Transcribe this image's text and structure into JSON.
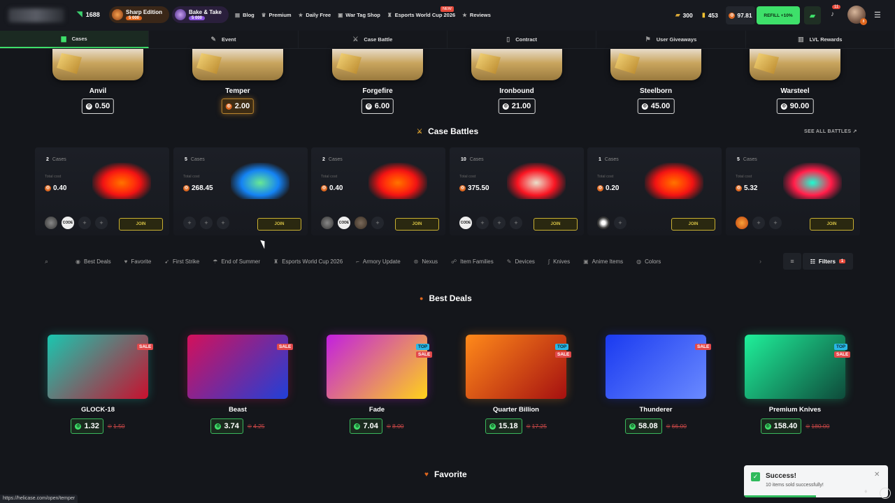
{
  "header": {
    "online_count": "1688",
    "promos": [
      {
        "title": "Sharp Edition",
        "sub": "5 000",
        "color": "#e0671e"
      },
      {
        "title": "Bake & Take",
        "sub": "5 000",
        "color": "#8a52e0"
      }
    ],
    "nav": [
      {
        "label": "Blog",
        "icon": "blog-icon"
      },
      {
        "label": "Premium",
        "icon": "crown-icon"
      },
      {
        "label": "Daily Free",
        "icon": "star-icon"
      },
      {
        "label": "War Tag Shop",
        "icon": "shop-icon"
      },
      {
        "label": "Esports World Cup 2026",
        "icon": "trophy-icon"
      },
      {
        "label": "Reviews",
        "icon": "star-icon"
      }
    ],
    "new_badge": "NEW",
    "coins_gold": "300",
    "coins_yellow": "453",
    "balance": "97.81",
    "refill_label": "REFILL +10%",
    "notifications": "11",
    "level": "8"
  },
  "tabs": [
    {
      "label": "Cases",
      "icon": "case-icon"
    },
    {
      "label": "Event",
      "icon": "pen-icon"
    },
    {
      "label": "Case Battle",
      "icon": "swords-icon"
    },
    {
      "label": "Contract",
      "icon": "document-icon"
    },
    {
      "label": "User Giveaways",
      "icon": "giveaway-icon"
    },
    {
      "label": "LVL Rewards",
      "icon": "bar-chart-icon"
    }
  ],
  "top_cases": [
    {
      "name": "Anvil",
      "price": "0.50"
    },
    {
      "name": "Temper",
      "price": "2.00"
    },
    {
      "name": "Forgefire",
      "price": "6.00"
    },
    {
      "name": "Ironbound",
      "price": "21.00"
    },
    {
      "name": "Steelborn",
      "price": "45.00"
    },
    {
      "name": "Warsteel",
      "price": "90.00"
    }
  ],
  "battles_section": {
    "title": "Case Battles",
    "see_all": "SEE ALL BATTLES"
  },
  "battles": [
    {
      "cases": "2",
      "total_label": "Total cost",
      "total": "0.40",
      "colors": [
        "#ff7a1a",
        "#c81e1e"
      ],
      "join": "JOIN"
    },
    {
      "cases": "5",
      "total_label": "Total cost",
      "total": "268.45",
      "colors": [
        "#7ee0a0",
        "#2a7fd6"
      ],
      "join": "JOIN"
    },
    {
      "cases": "2",
      "total_label": "Total cost",
      "total": "0.40",
      "colors": [
        "#ff7a1a",
        "#c81e1e"
      ],
      "join": "JOIN"
    },
    {
      "cases": "10",
      "total_label": "Total cost",
      "total": "375.50",
      "colors": [
        "#e8e0d0",
        "#d0202a"
      ],
      "join": "JOIN"
    },
    {
      "cases": "1",
      "total_label": "Total cost",
      "total": "0.20",
      "colors": [
        "#ff7a1a",
        "#c81e1e"
      ],
      "join": "JOIN"
    },
    {
      "cases": "5",
      "total_label": "Total cost",
      "total": "5.32",
      "colors": [
        "#44f0d0",
        "#e0284a"
      ],
      "join": "JOIN"
    }
  ],
  "cases_label": "Cases",
  "code_label": "CODE",
  "filter_chips": [
    {
      "label": "Best Deals",
      "icon": "deal-icon"
    },
    {
      "label": "Favorite",
      "icon": "heart-icon"
    },
    {
      "label": "First Strike",
      "icon": "rocket-icon"
    },
    {
      "label": "End of Summer",
      "icon": "beach-icon"
    },
    {
      "label": "Esports World Cup 2026",
      "icon": "trophy-icon"
    },
    {
      "label": "Armory Update",
      "icon": "gun-icon"
    },
    {
      "label": "Nexus",
      "icon": "nexus-icon"
    },
    {
      "label": "Item Families",
      "icon": "family-icon"
    },
    {
      "label": "Devices",
      "icon": "device-icon"
    },
    {
      "label": "Knives",
      "icon": "knife-icon"
    },
    {
      "label": "Anime Items",
      "icon": "anime-icon"
    },
    {
      "label": "Colors",
      "icon": "palette-icon"
    }
  ],
  "filters_label": "Filters",
  "filters_count": "1",
  "best_deals_title": "Best Deals",
  "deals": [
    {
      "name": "GLOCK-18",
      "price": "1.32",
      "old": "1.50",
      "badges": [
        "SALE"
      ],
      "colors": [
        "#19c7b0",
        "#c8102e"
      ]
    },
    {
      "name": "Beast",
      "price": "3.74",
      "old": "4.25",
      "badges": [
        "SALE"
      ],
      "colors": [
        "#d4105a",
        "#2040d8"
      ]
    },
    {
      "name": "Fade",
      "price": "7.04",
      "old": "8.00",
      "badges": [
        "TOP",
        "SALE"
      ],
      "colors": [
        "#c21fe0",
        "#ffd21a"
      ]
    },
    {
      "name": "Quarter Billion",
      "price": "15.18",
      "old": "17.25",
      "badges": [
        "TOP",
        "SALE"
      ],
      "colors": [
        "#ff8a1a",
        "#a51010"
      ]
    },
    {
      "name": "Thunderer",
      "price": "58.08",
      "old": "66.00",
      "badges": [
        "SALE"
      ],
      "colors": [
        "#1a3af0",
        "#6a8aff"
      ]
    },
    {
      "name": "Premium Knives",
      "price": "158.40",
      "old": "180.00",
      "badges": [
        "TOP",
        "SALE"
      ],
      "colors": [
        "#1ff09a",
        "#0e4a3a"
      ]
    }
  ],
  "favorite_title": "Favorite",
  "toast": {
    "title": "Success!",
    "message": "10 items sold successfully!",
    "progress": 0.5
  },
  "status_url": "https://helicase.com/open/temper"
}
